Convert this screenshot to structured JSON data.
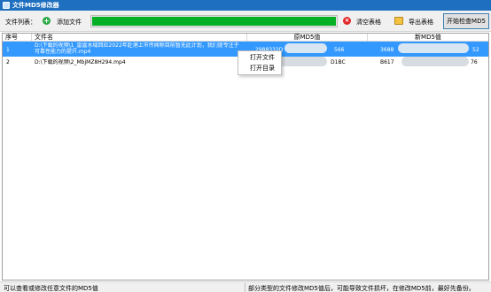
{
  "window": {
    "title": "文件MD5修改器"
  },
  "toolbar": {
    "file_list_label": "文件列表：",
    "add_file_label": "添加文件",
    "progress_percent": 100,
    "progress_color": "#06b025",
    "clear_table_label": "清空表格",
    "export_table_label": "导出表格",
    "start_check_label": "开始检查MD5",
    "add_icon": "add-circle-icon",
    "clear_icon": "close-circle-icon",
    "export_icon": "folder-export-icon"
  },
  "table": {
    "columns": [
      "序号",
      "文件名",
      "原MD5值",
      "新MD5值"
    ],
    "rows": [
      {
        "index": "1",
        "filename": "D:\\下载的视频\\1_雷霆水域回应2022年赴港上市传闻称目前暂无此计划，我们提专注于可靠性能力的提升.mp4",
        "original_md5": "2988332D",
        "original_md5_tail": "566",
        "new_md5": "3688",
        "new_md5_tail": "52",
        "selected": true
      },
      {
        "index": "2",
        "filename": "D:\\下载的视频\\2_MbjMZ8H294.mp4",
        "original_md5": "B7",
        "original_md5_tail": "D1BC",
        "new_md5": "B617",
        "new_md5_tail": "76",
        "selected": false
      }
    ]
  },
  "context_menu": {
    "items": [
      "打开文件",
      "打开目录"
    ]
  },
  "statusbar": {
    "left_text": "可以查看或修改任意文件的MD5值",
    "right_text": "部分类型的文件修改MD5值后，可能导致文件损坏，在修改MD5前，最好先备份。"
  },
  "colors": {
    "titlebar": "#1e6fbf",
    "selection": "#3399ff",
    "accent_border": "#3c7fb1"
  }
}
